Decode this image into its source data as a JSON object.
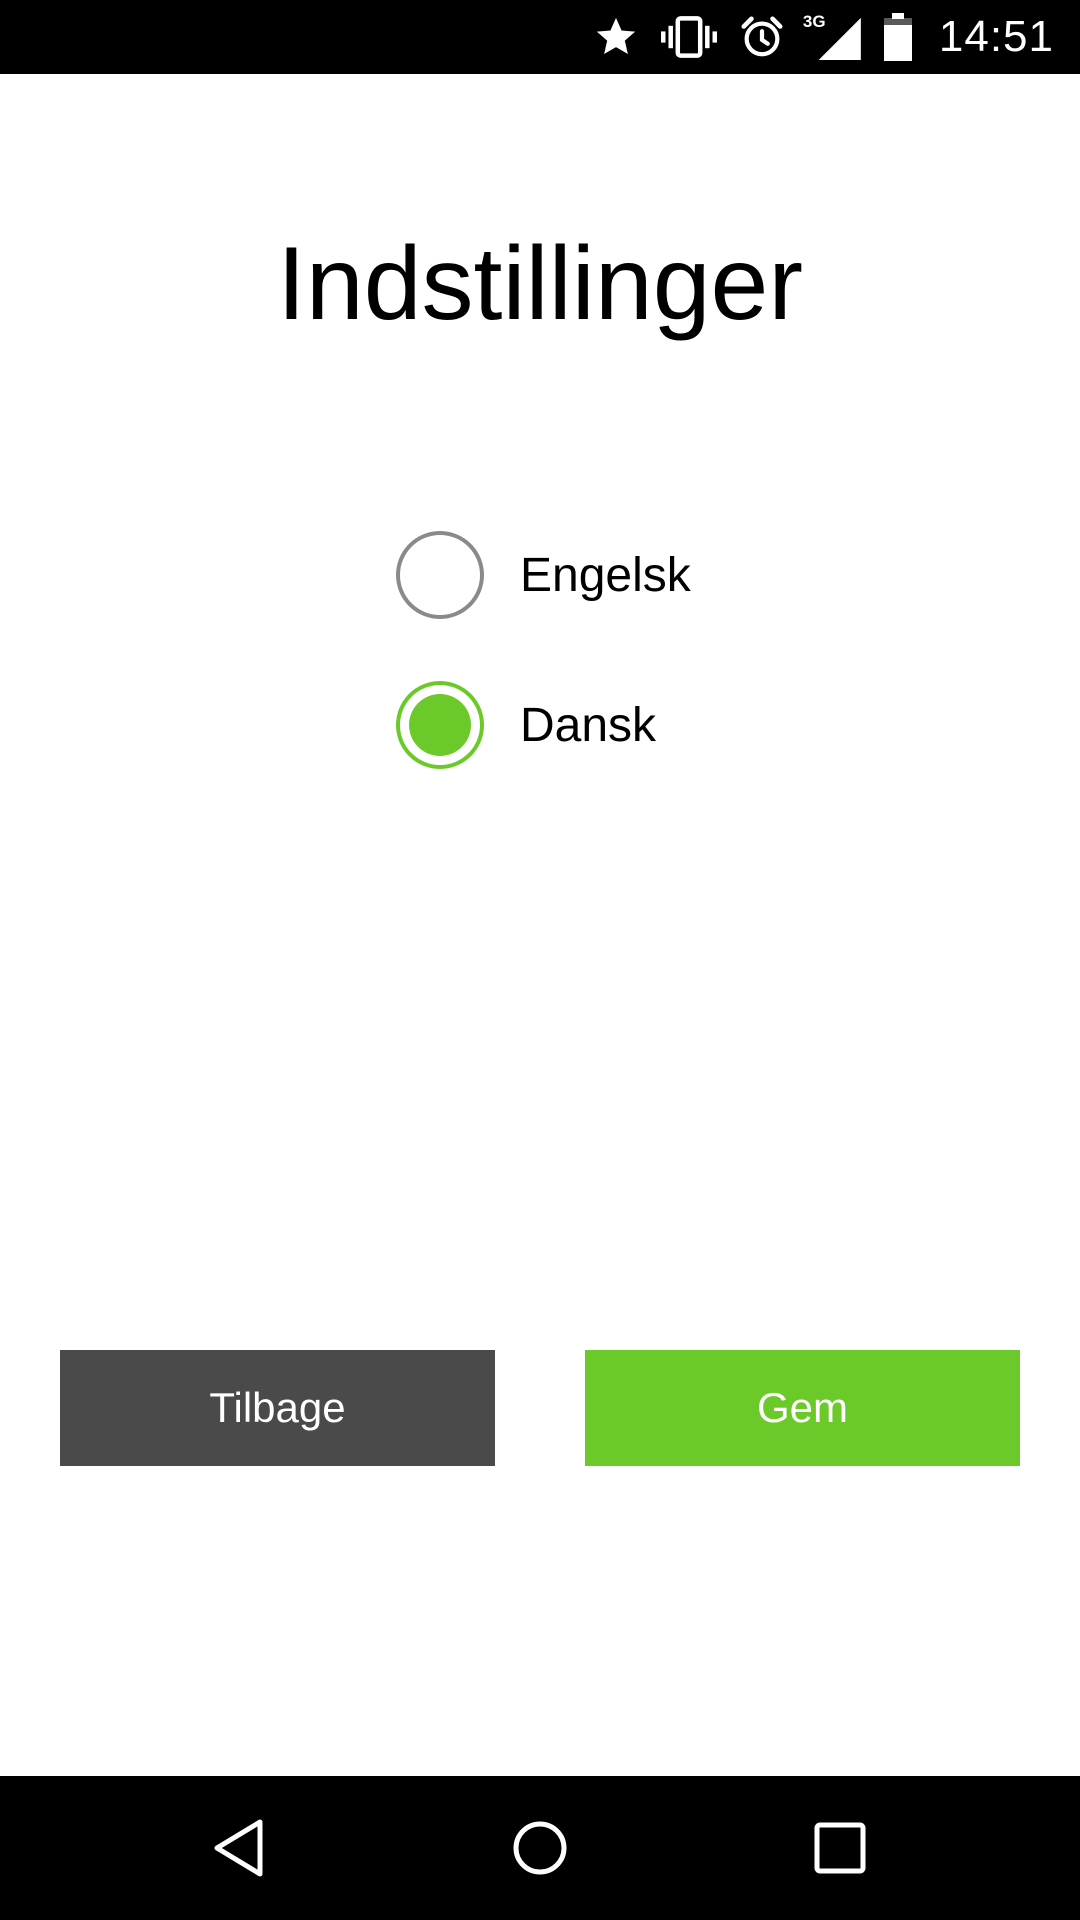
{
  "status_bar": {
    "time": "14:51",
    "network": "3G",
    "icons": [
      "star-icon",
      "vibrate-icon",
      "alarm-icon",
      "signal-icon",
      "battery-icon"
    ]
  },
  "page": {
    "title": "Indstillinger"
  },
  "language_options": [
    {
      "label": "Engelsk",
      "selected": false
    },
    {
      "label": "Dansk",
      "selected": true
    }
  ],
  "buttons": {
    "back_label": "Tilbage",
    "save_label": "Gem"
  },
  "colors": {
    "accent": "#6cc92a",
    "back_button": "#4a4a4a",
    "radio_unselected": "#8a8a8a"
  },
  "nav_bar": {
    "icons": [
      "back-icon",
      "home-icon",
      "recents-icon"
    ]
  }
}
